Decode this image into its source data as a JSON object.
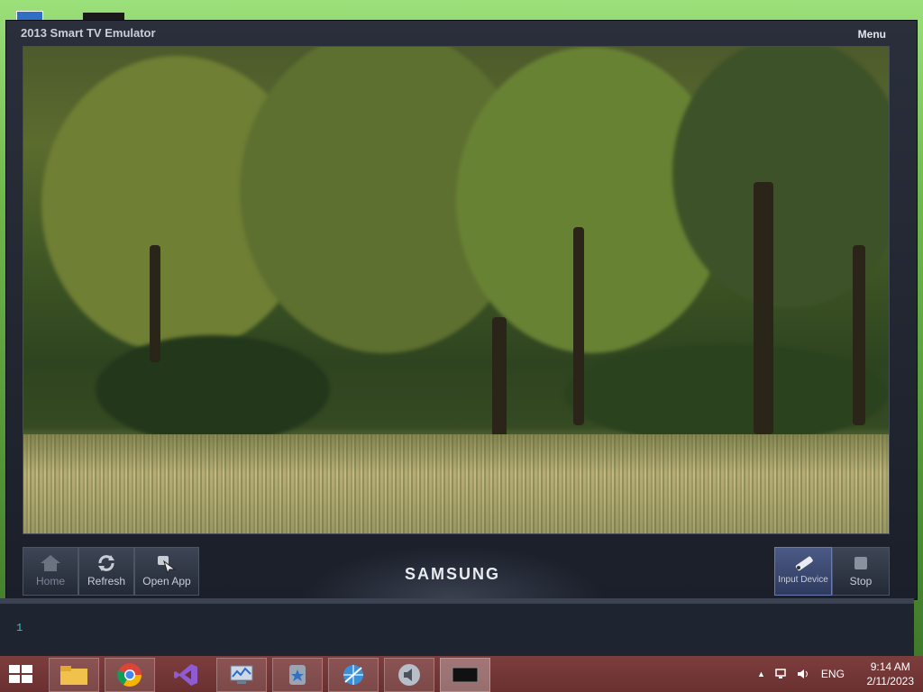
{
  "window": {
    "title": "2013 Smart TV Emulator",
    "menu_label": "Menu"
  },
  "controls": {
    "home_label": "Home",
    "refresh_label": "Refresh",
    "open_app_label": "Open App",
    "input_device_label": "Input Device",
    "stop_label": "Stop",
    "brand": "SAMSUNG"
  },
  "console": {
    "line": "1"
  },
  "taskbar": {
    "apps": [
      {
        "name": "file-explorer-icon"
      },
      {
        "name": "chrome-icon"
      },
      {
        "name": "visual-studio-icon"
      },
      {
        "name": "performance-monitor-icon"
      },
      {
        "name": "app-favorites-icon"
      },
      {
        "name": "network-globe-icon"
      },
      {
        "name": "speaker-app-icon"
      },
      {
        "name": "tv-emulator-icon"
      }
    ],
    "language": "ENG",
    "time": "9:14 AM",
    "date": "2/11/2023"
  },
  "colors": {
    "taskbar": "#6a3030",
    "emulator_frame": "#1b1f29",
    "console_text": "#3cc3c9"
  }
}
